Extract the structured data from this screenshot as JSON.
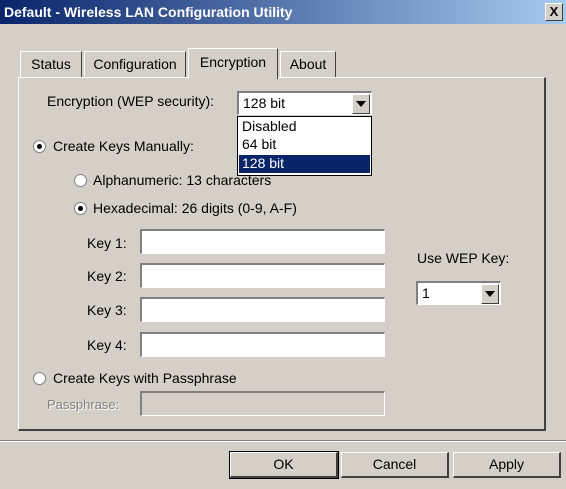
{
  "window": {
    "title": "Default - Wireless LAN Configuration Utility",
    "close_label": "X"
  },
  "tabs": [
    {
      "label": "Status",
      "active": false
    },
    {
      "label": "Configuration",
      "active": false
    },
    {
      "label": "Encryption",
      "active": true
    },
    {
      "label": "About",
      "active": false
    }
  ],
  "encryption": {
    "label": "Encryption (WEP security):",
    "selected": "128 bit",
    "options": [
      "Disabled",
      "64 bit",
      "128 bit"
    ]
  },
  "create_keys_manually": {
    "label": "Create Keys Manually:",
    "checked": true,
    "alphanumeric": {
      "label": "Alphanumeric: 13 characters",
      "checked": false
    },
    "hexadecimal": {
      "label": "Hexadecimal: 26 digits (0-9, A-F)",
      "checked": true
    }
  },
  "keys": [
    {
      "label": "Key 1:",
      "value": ""
    },
    {
      "label": "Key 2:",
      "value": ""
    },
    {
      "label": "Key 3:",
      "value": ""
    },
    {
      "label": "Key 4:",
      "value": ""
    }
  ],
  "use_wep_key": {
    "label": "Use WEP Key:",
    "value": "1"
  },
  "create_keys_passphrase": {
    "label": "Create Keys with Passphrase",
    "checked": false
  },
  "passphrase": {
    "label": "Passphrase:",
    "value": ""
  },
  "buttons": {
    "ok": "OK",
    "cancel": "Cancel",
    "apply": "Apply"
  }
}
